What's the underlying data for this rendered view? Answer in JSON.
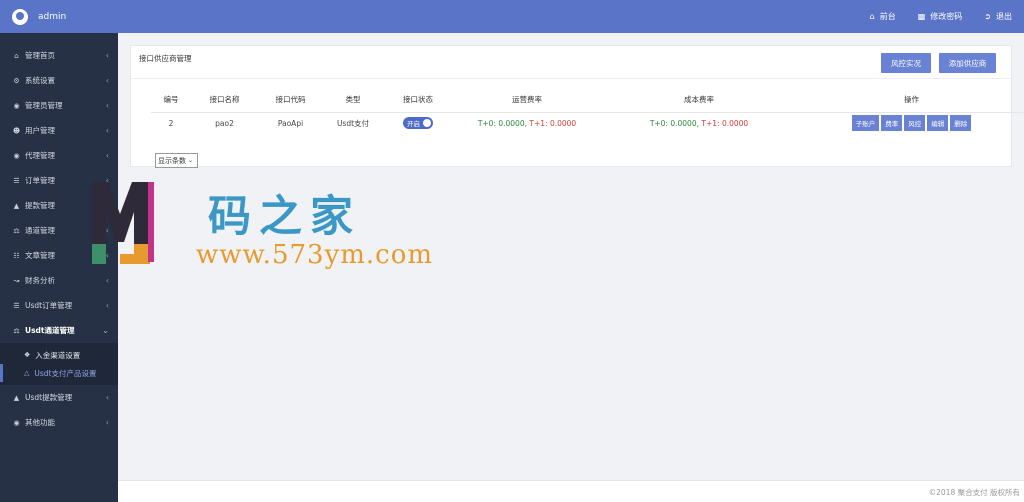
{
  "topbar": {
    "username": "admin",
    "links": [
      {
        "icon": "home-icon",
        "label": "前台"
      },
      {
        "icon": "lock-icon",
        "label": "修改密码"
      },
      {
        "icon": "logout-icon",
        "label": "退出"
      }
    ]
  },
  "sidebar": {
    "items": [
      {
        "label": "管理首页"
      },
      {
        "label": "系统设置"
      },
      {
        "label": "管理员管理"
      },
      {
        "label": "用户管理"
      },
      {
        "label": "代理管理"
      },
      {
        "label": "订单管理"
      },
      {
        "label": "提款管理"
      },
      {
        "label": "通道管理"
      },
      {
        "label": "文章管理"
      },
      {
        "label": "财务分析"
      },
      {
        "label": "Usdt订单管理"
      },
      {
        "label": "Usdt通道管理"
      },
      {
        "label": "Usdt提款管理"
      },
      {
        "label": "其他功能"
      }
    ],
    "submenu": [
      {
        "label": "入金渠道设置"
      },
      {
        "label": "Usdt支付产品设置"
      }
    ]
  },
  "panel": {
    "title": "接口供应商管理",
    "btn_risk": "风控实况",
    "btn_add": "添加供应商"
  },
  "table": {
    "headers": [
      "编号",
      "接口名称",
      "接口代码",
      "类型",
      "接口状态",
      "运营费率",
      "成本费率",
      "操作"
    ],
    "rows": [
      {
        "id": "2",
        "name": "pao2",
        "code": "PaoApi",
        "type": "Usdt支付",
        "status": "开启",
        "op_t0": "T+0: 0.0000,",
        "op_t1": "T+1: 0.0000",
        "cost_t0": "T+0: 0.0000,",
        "cost_t1": "T+1: 0.0000"
      }
    ],
    "actions": [
      "子账户",
      "费率",
      "风控",
      "编辑",
      "删除"
    ]
  },
  "pagesize": "显示条数",
  "footer": "©2018 聚合支付 版权所有",
  "watermark": {
    "text": "码之家",
    "url": "www.573ym.com"
  }
}
